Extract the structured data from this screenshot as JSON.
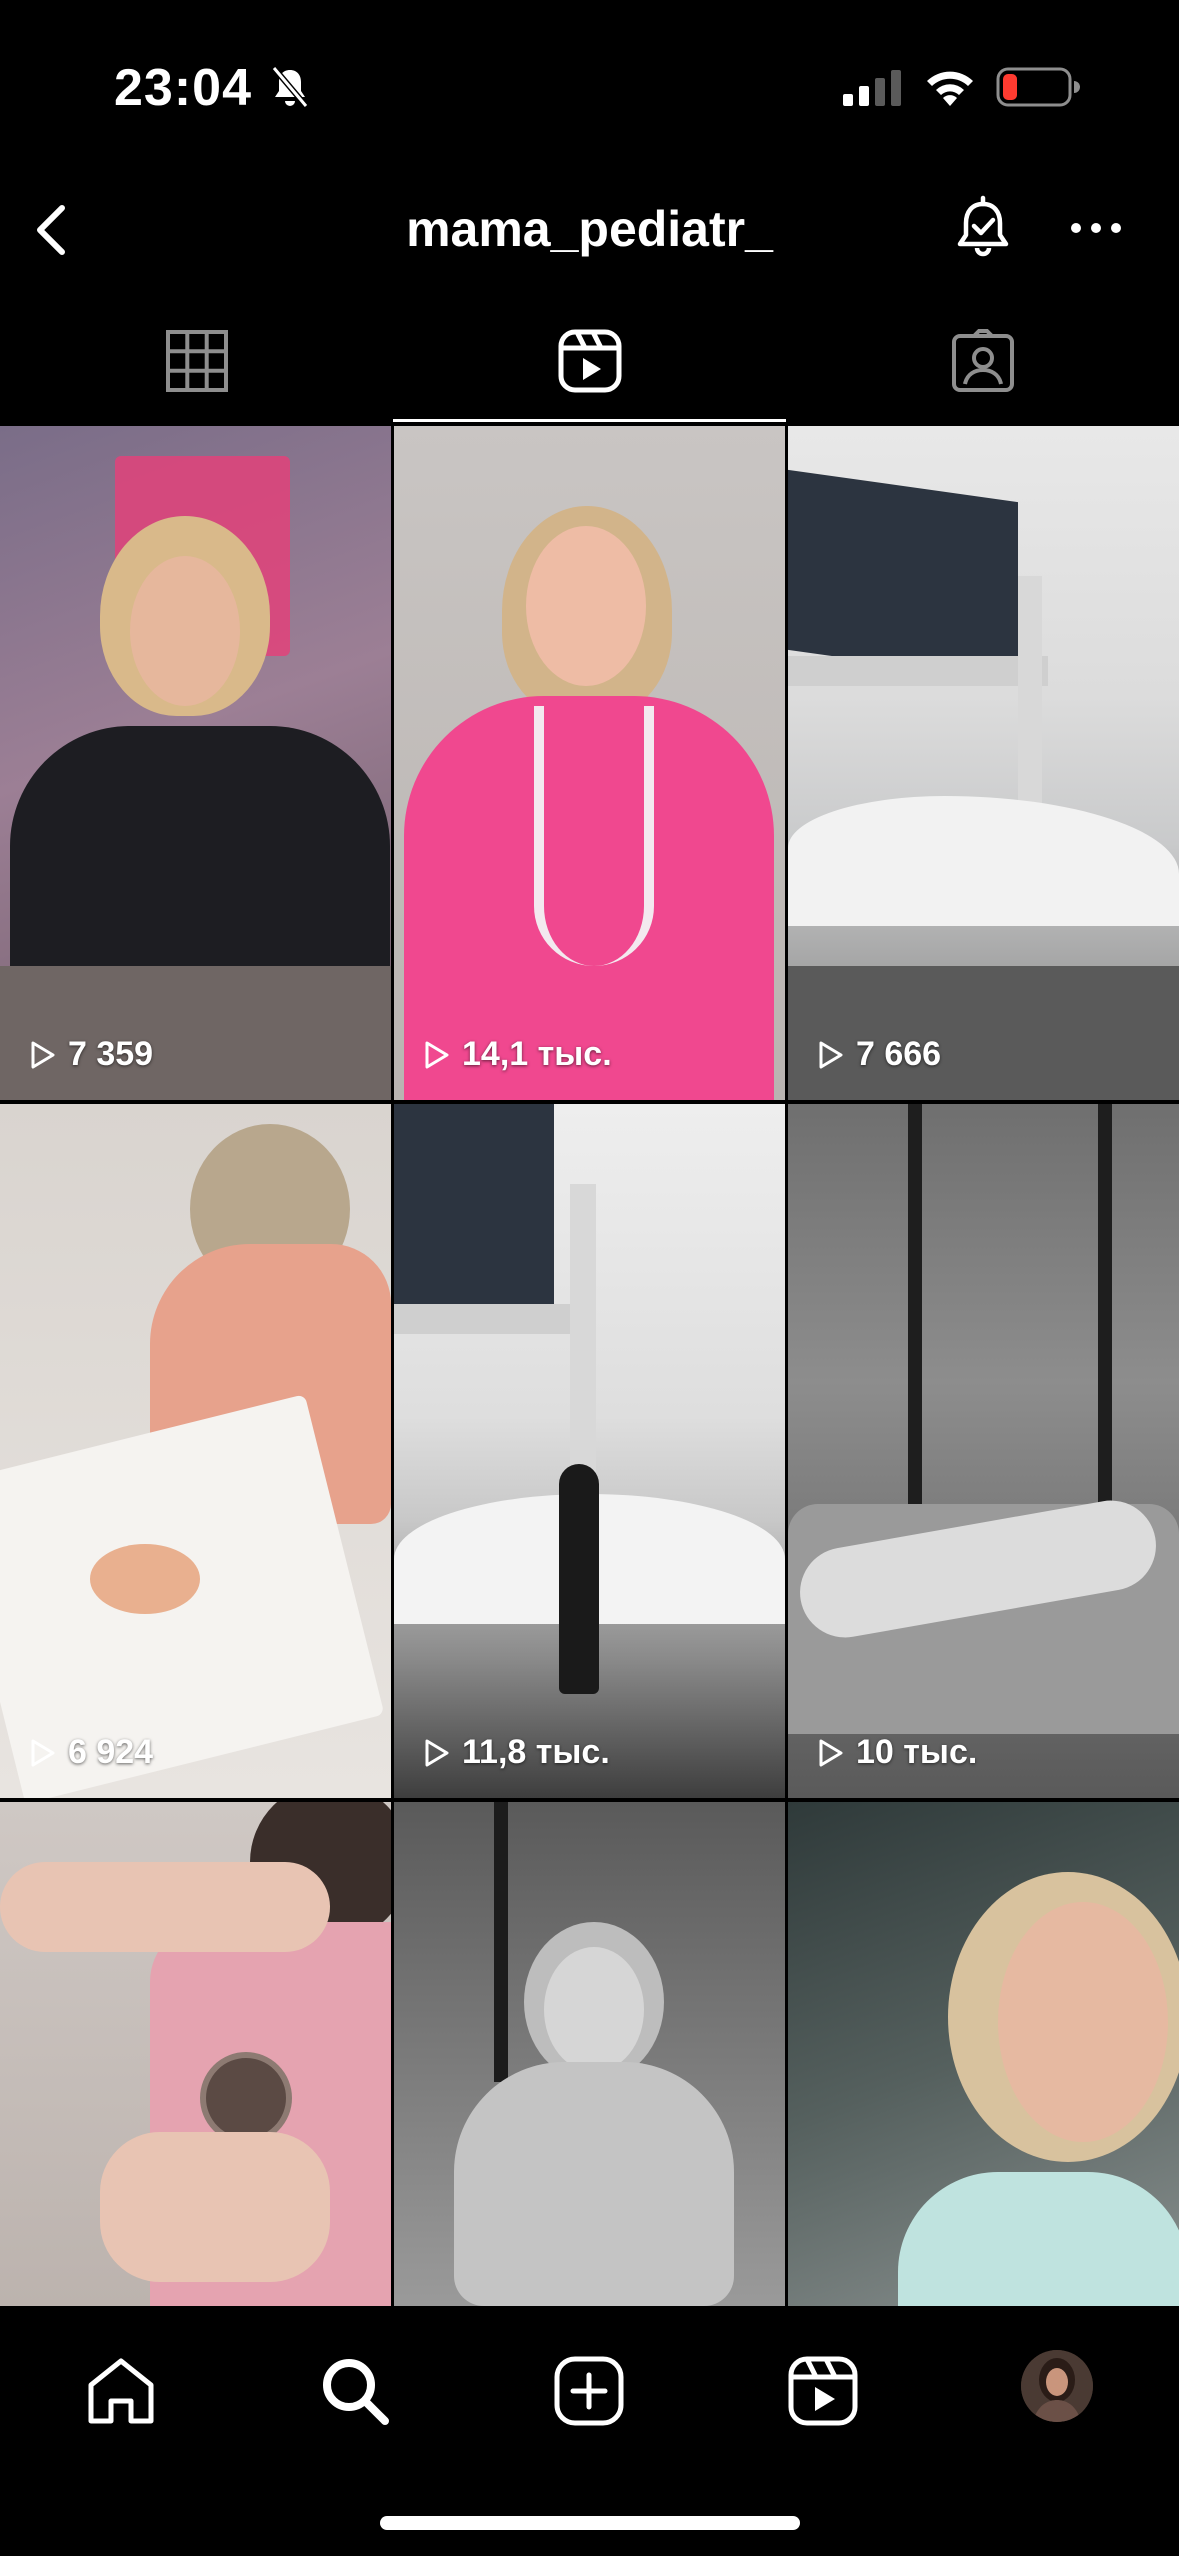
{
  "status_bar": {
    "time": "23:04",
    "icons": [
      "bell-slash-icon",
      "cellular-signal-icon",
      "wifi-icon",
      "battery-low-icon"
    ],
    "battery_color": "#ff3b30"
  },
  "header": {
    "title": "mama_pediatr_",
    "icons": [
      "back-chevron-icon",
      "notification-bell-check-icon",
      "more-dots-icon"
    ]
  },
  "tabs": [
    {
      "name": "grid-icon",
      "active": false
    },
    {
      "name": "reels-icon",
      "active": true
    },
    {
      "name": "tagged-icon",
      "active": false
    }
  ],
  "reels": [
    {
      "views": "7 359"
    },
    {
      "views": "14,1 тыс."
    },
    {
      "views": "7 666"
    },
    {
      "views": "6 924"
    },
    {
      "views": "11,8 тыс."
    },
    {
      "views": "10 тыс."
    },
    {
      "views": ""
    },
    {
      "views": ""
    },
    {
      "views": ""
    }
  ],
  "bottom_nav": [
    "home-icon",
    "search-icon",
    "create-icon",
    "reels-nav-icon",
    "profile-avatar"
  ],
  "colors": {
    "background": "#000000",
    "text": "#ffffff",
    "accent_pink": "#f0488f"
  }
}
